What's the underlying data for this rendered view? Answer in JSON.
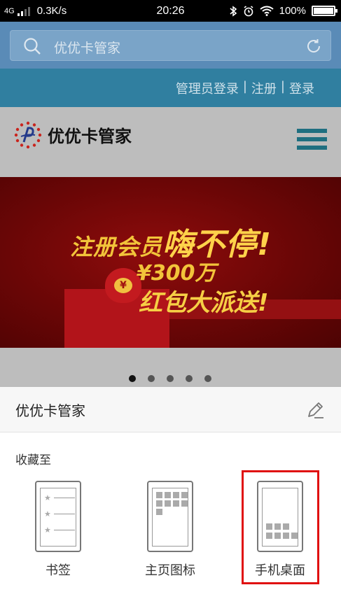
{
  "status_bar": {
    "network": "4G",
    "speed": "0.3K/s",
    "time": "20:26",
    "battery": "100%"
  },
  "search": {
    "placeholder": "优优卡管家"
  },
  "auth_links": {
    "admin": "管理员登录",
    "register": "注册",
    "login": "登录",
    "separator": "|"
  },
  "brand": {
    "name": "优优卡管家"
  },
  "banner": {
    "line1_prefix": "注册会员",
    "line1_emph": "嗨不停!",
    "line2": "¥300万",
    "line3": "红包大派送!",
    "bag_symbol": "¥"
  },
  "carousel": {
    "count": 5,
    "active_index": 0
  },
  "sheet": {
    "title": "优优卡管家",
    "collect_label": "收藏至",
    "options": [
      {
        "label": "书签",
        "icon": "bookmark-list-icon"
      },
      {
        "label": "主页图标",
        "icon": "home-grid-icon"
      },
      {
        "label": "手机桌面",
        "icon": "phone-desktop-icon",
        "highlighted": true
      }
    ]
  },
  "colors": {
    "search_bg": "#5a8bb7",
    "login_bar": "#307fa0",
    "highlight": "#e01010",
    "banner_gold": "#f2c43a"
  }
}
